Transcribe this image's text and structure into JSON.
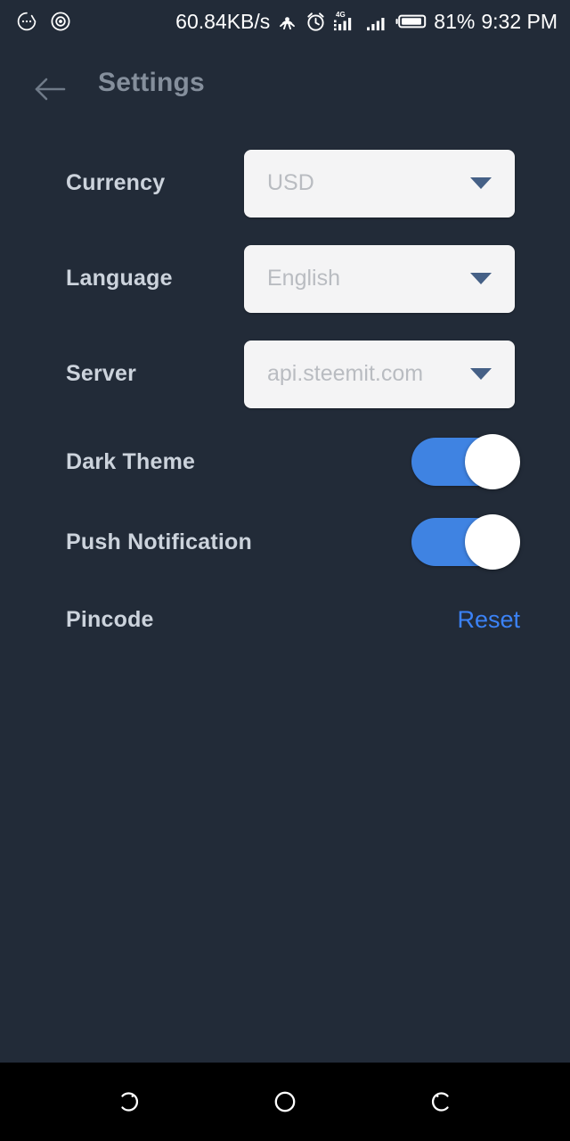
{
  "status_bar": {
    "left_icons": [
      {
        "name": "chat-bubble-icon"
      },
      {
        "name": "record-circle-icon"
      }
    ],
    "network_speed": "60.84KB/s",
    "right_icons": [
      {
        "name": "hotspot-icon"
      },
      {
        "name": "alarm-clock-icon"
      },
      {
        "name": "signal-4g-icon",
        "label": "4G"
      },
      {
        "name": "signal-bars-icon"
      },
      {
        "name": "battery-icon"
      }
    ],
    "battery_percent": "81%",
    "time": "9:32 PM"
  },
  "header": {
    "back_label": "Back",
    "title": "Settings"
  },
  "settings": {
    "rows": [
      {
        "type": "select",
        "label": "Currency",
        "value": "USD",
        "name": "currency"
      },
      {
        "type": "select",
        "label": "Language",
        "value": "English",
        "name": "language"
      },
      {
        "type": "select",
        "label": "Server",
        "value": "api.steemit.com",
        "name": "server"
      },
      {
        "type": "toggle",
        "label": "Dark Theme",
        "value": "on",
        "name": "dark-theme"
      },
      {
        "type": "toggle",
        "label": "Push Notification",
        "value": "on",
        "name": "push-notification"
      },
      {
        "type": "action",
        "label": "Pincode",
        "action_label": "Reset",
        "name": "pincode"
      }
    ]
  },
  "nav_bar": {
    "recents_label": "Recents",
    "home_label": "Home",
    "back_label": "Back"
  },
  "colors": {
    "background": "#222b38",
    "accent_blue": "#3f83e2",
    "link_blue": "#3b82f6",
    "label_gray": "#ccd3dc",
    "title_gray": "#858f9c",
    "field_bg": "#f4f4f5",
    "field_text": "#b9bcc1",
    "caret": "#456086",
    "navbar_bg": "#000000"
  }
}
